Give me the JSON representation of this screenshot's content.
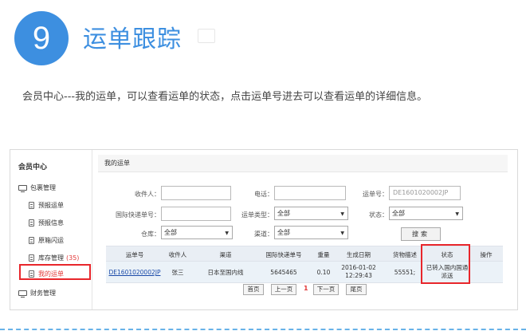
{
  "step": {
    "number": "9",
    "title": "运单跟踪"
  },
  "description": "会员中心---我的运单，可以查看运单的状态，点击运单号进去可以查看运单的详细信息。",
  "sidebar": {
    "header": "会员中心",
    "group": "包裹管理",
    "items": [
      "预报运单",
      "预报信息",
      "原箱闪运",
      "库存管理",
      "我的运单"
    ],
    "inventory_count": "(35)",
    "finance": "财务管理"
  },
  "panel_title": "我的运单",
  "filters": {
    "recipient_label": "收件人：",
    "phone_label": "电话：",
    "waybill_label": "运单号：",
    "waybill_placeholder": "DE1601020002JP",
    "intl_no_label": "国际快递单号：",
    "type_label": "运单类型：",
    "type_value": "全部",
    "status_label": "状态：",
    "status_value": "全部",
    "warehouse_label": "仓库：",
    "warehouse_value": "全部",
    "channel_label": "渠道：",
    "channel_value": "全部",
    "search_label": "搜索"
  },
  "table": {
    "headers": [
      "运单号",
      "收件人",
      "渠道",
      "国际快递单号",
      "重量",
      "生成日期",
      "货物描述",
      "状态",
      "操作"
    ],
    "rows": [
      {
        "waybill": "DE1601020002JP",
        "recipient": "张三",
        "channel": "日本至国内线",
        "intl_no": "5645465",
        "weight": "0.10",
        "date": "2016-01-02",
        "time": "12:29:43",
        "desc": "55551;",
        "status_1": "已转入国内国通",
        "status_2": "派送",
        "action": ""
      }
    ]
  },
  "pager": {
    "first": "首页",
    "prev": "上一页",
    "current": "1",
    "next": "下一页",
    "last": "尾页"
  },
  "colors": {
    "accent": "#3d8fe0",
    "highlight": "#e8262b",
    "dashed": "#68b2e8"
  }
}
